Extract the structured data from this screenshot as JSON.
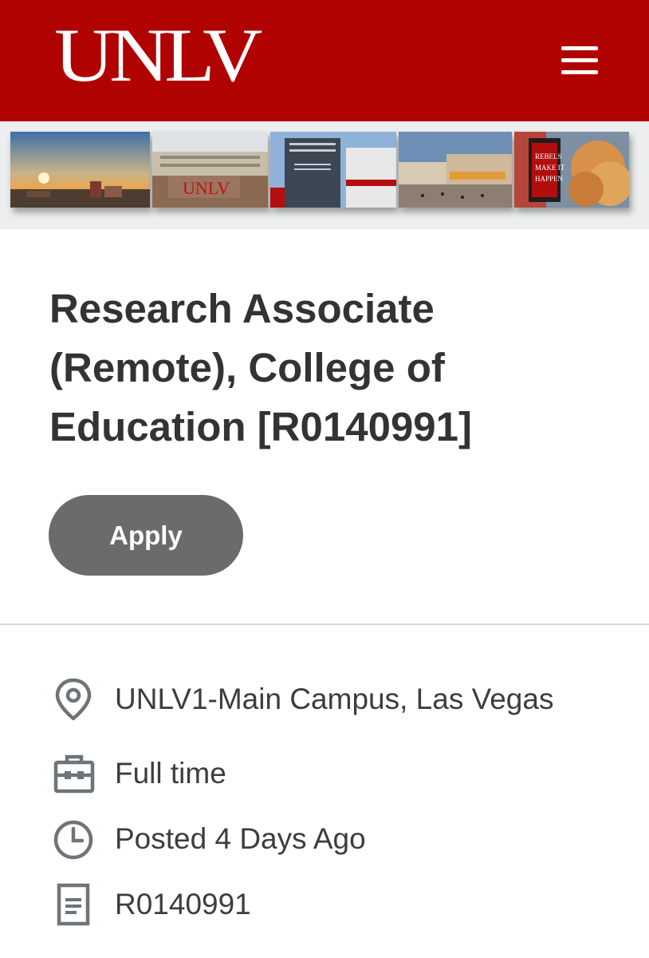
{
  "header": {
    "logo_text": "UNLV",
    "menu_icon": "hamburger-menu-icon",
    "background_color": "#b10202"
  },
  "banner": {
    "photos": [
      "campus-sunset-photo",
      "unlv-sign-building-photo",
      "school-of-medicine-sign-photo",
      "student-plaza-photo",
      "rebels-make-it-happen-banner-photo"
    ]
  },
  "job": {
    "title": "Research Associate (Remote), College of Education [R0140991]",
    "apply_label": "Apply"
  },
  "details": {
    "location": "UNLV1-Main Campus, Las Vegas",
    "location_icon": "location-pin-icon",
    "time_type": "Full time",
    "time_type_icon": "briefcase-icon",
    "posted": "Posted 4 Days Ago",
    "posted_icon": "clock-icon",
    "job_id": "R0140991",
    "job_id_icon": "document-icon"
  }
}
